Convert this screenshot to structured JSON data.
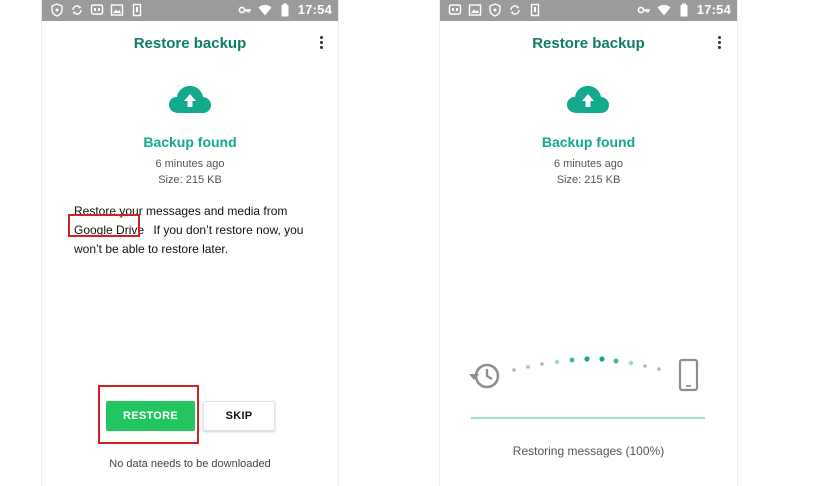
{
  "status_bar": {
    "time": "17:54",
    "left_icons": [
      "shield-icon",
      "sync-icon",
      "message-icon",
      "image-icon",
      "battery-saver-icon"
    ],
    "right_icons": [
      "key-icon",
      "wifi-icon",
      "battery-icon"
    ]
  },
  "left_screen": {
    "title": "Restore backup",
    "backup_found": "Backup found",
    "time_ago": "6 minutes ago",
    "size": "Size: 215 KB",
    "message_line1": "Restore your messages and media from",
    "message_highlight": "Google Drive",
    "message_line2_rest": "If you don’t restore now, you",
    "message_line3": "won’t be able to restore later.",
    "restore_label": "RESTORE",
    "skip_label": "SKIP",
    "bottom_note": "No data needs to be downloaded"
  },
  "right_screen": {
    "title": "Restore backup",
    "backup_found": "Backup found",
    "time_ago": "6 minutes ago",
    "size": "Size: 215 KB",
    "progress_status": "Restoring messages (100%)",
    "progress_percent": 100
  },
  "colors": {
    "status_bar": "#9b9b9b",
    "title": "#0e7d69",
    "accent": "#12a98c",
    "restore_button": "#22c560",
    "highlight_box": "#d32027",
    "progress": "#9ee3c8"
  }
}
